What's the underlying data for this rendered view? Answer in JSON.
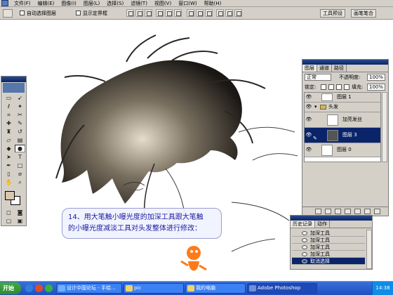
{
  "menu": {
    "items": [
      "文件(F)",
      "编辑(E)",
      "图像(I)",
      "图层(L)",
      "选择(S)",
      "滤镜(T)",
      "视图(V)",
      "窗口(W)",
      "帮助(H)"
    ]
  },
  "options": {
    "auto_select_layer": "自动选择图层",
    "show_bounds": "显示定界框",
    "dock_tabs": [
      "工具预设",
      "画笔笔合"
    ]
  },
  "layers_panel": {
    "tabs": [
      "图层",
      "通道",
      "路径"
    ],
    "blend_mode": "正常",
    "opacity_label": "不透明度:",
    "opacity_value": "100%",
    "lock_label": "锁定:",
    "fill_label": "填充:",
    "fill_value": "100%",
    "layers": [
      {
        "name": "图层 1",
        "selected": false
      },
      {
        "name": "头发",
        "selected": false
      },
      {
        "name": "加亮发丝",
        "selected": false
      },
      {
        "name": "图层 3",
        "selected": true
      },
      {
        "name": "图层 0",
        "selected": false
      }
    ]
  },
  "history_panel": {
    "tabs": [
      "历史记录",
      "动作"
    ],
    "items": [
      "加深工具",
      "加深工具",
      "加深工具",
      "加深工具",
      "取消选择"
    ]
  },
  "caption": {
    "line1": "14、用大笔触小曝光度的加深工具跟大笔触",
    "line2": "的小曝光度减淡工具对头发整体进行修改："
  },
  "taskbar": {
    "start_label": "开始",
    "buttons": [
      "设计中国论坛 - 手绘...",
      "pic",
      "我的电脑",
      "Adobe Photoshop"
    ],
    "clock": "14:38"
  },
  "colors": {
    "foreground": "#d8c7ad",
    "background": "#ffffff",
    "selection": "#0a246a",
    "caption_text": "#1a1aa0"
  }
}
